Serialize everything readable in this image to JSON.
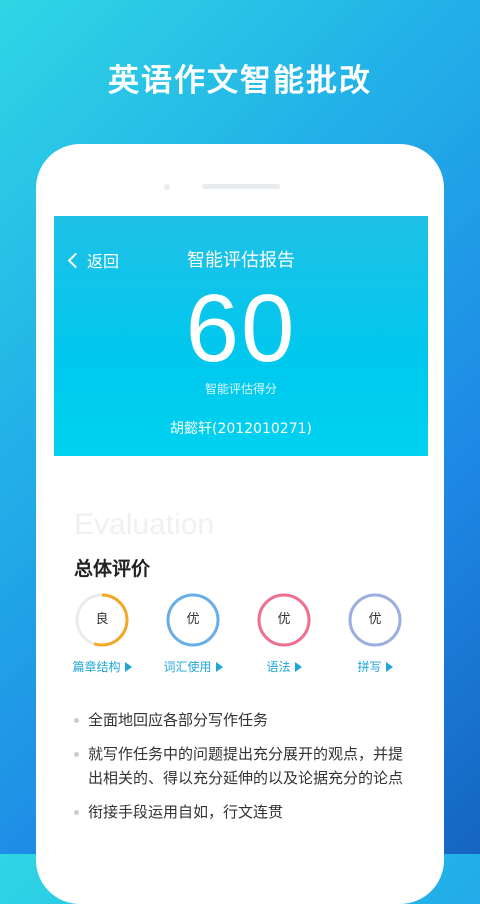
{
  "headline": "英语作文智能批改",
  "report": {
    "back_label": "返回",
    "title": "智能评估报告",
    "score": "60",
    "score_label": "智能评估得分",
    "student": "胡懿轩(2012010271)"
  },
  "evaluation": {
    "watermark": "Evaluation",
    "section_title": "总体评价",
    "ratings": [
      {
        "grade": "良",
        "label": "篇章结构",
        "color": "#f5a623",
        "progress": 0.55
      },
      {
        "grade": "优",
        "label": "词汇使用",
        "color": "#6aaee8",
        "progress": 1.0
      },
      {
        "grade": "优",
        "label": "语法",
        "color": "#ee6f8f",
        "progress": 1.0
      },
      {
        "grade": "优",
        "label": "拼写",
        "color": "#9aaee0",
        "progress": 1.0
      }
    ],
    "bullets": [
      "全面地回应各部分写作任务",
      "就写作任务中的问题提出充分展开的观点，并提出相关的、得以充分延伸的以及论据充分的论点",
      "衔接手段运用自如，行文连贯"
    ]
  }
}
